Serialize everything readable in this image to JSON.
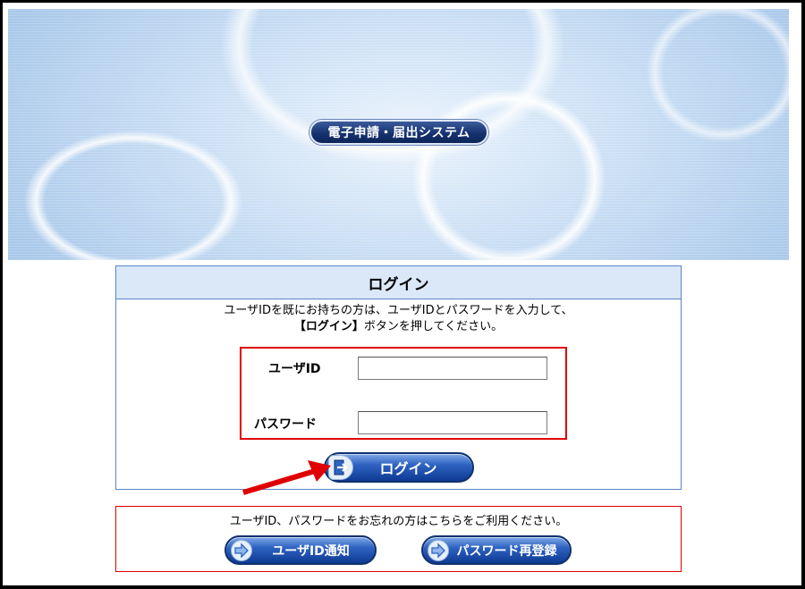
{
  "banner": {
    "title": "電子申請・届出システム"
  },
  "login": {
    "header": "ログイン",
    "instruction_line1": "ユーザIDを既にお持ちの方は、ユーザIDとパスワードを入力して、",
    "instruction_line2_bold": "【ログイン】",
    "instruction_line2_rest": "ボタンを押してください。",
    "user_id_label": "ユーザID",
    "user_id_value": "",
    "password_label": "パスワード",
    "password_value": "",
    "login_button_label": "ログイン"
  },
  "help": {
    "text": "ユーザID、パスワードをお忘れの方はこちらをご利用ください。",
    "notify_button_label": "ユーザID通知",
    "reset_button_label": "パスワード再登録"
  },
  "colors": {
    "highlight_red": "#e00000",
    "button_blue": "#0d3a93",
    "header_bg": "#dbe8f8"
  },
  "icons": {
    "login_button": "door-arrow-icon",
    "notify_button": "arrow-right-icon",
    "reset_button": "arrow-right-icon",
    "annotation": "red-pointer-arrow"
  }
}
